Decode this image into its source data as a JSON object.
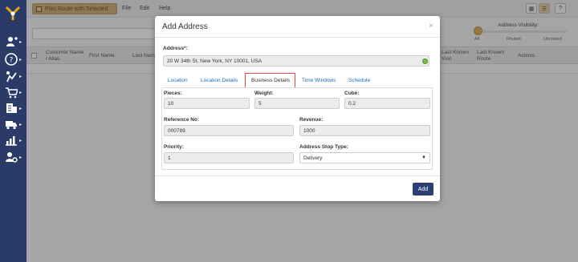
{
  "toolbar": {
    "plan_route_label": "Plan Route with Selected",
    "menu": [
      "File",
      "Edit",
      "Help"
    ]
  },
  "address_visibility": {
    "title": "Address Visibility:",
    "ticks": [
      "All",
      "Routed",
      "Unrouted"
    ],
    "level": 0
  },
  "grid": {
    "columns": [
      "Customer Name / Alias",
      "First Name",
      "Last Name",
      "Last Known Visit",
      "Last Known Route",
      "Actions"
    ]
  },
  "modal": {
    "title": "Add Address",
    "close": "×",
    "address_label": "Address*:",
    "address_value": "20 W 34th St, New York, NY 10001, USA",
    "tabs": [
      "Location",
      "Location Details",
      "Business Details",
      "Time Windows",
      "Schedule"
    ],
    "active_tab": "Business Details",
    "fields": {
      "pieces_label": "Pieces:",
      "pieces_value": "10",
      "weight_label": "Weight:",
      "weight_value": "5",
      "cube_label": "Cube:",
      "cube_value": "0.2",
      "reference_label": "Reference No:",
      "reference_value": "000789",
      "revenue_label": "Revenue:",
      "revenue_value": "1000",
      "priority_label": "Priority:",
      "priority_value": "1",
      "stop_type_label": "Address Stop Type:",
      "stop_type_value": "Delivery"
    },
    "add_button": "Add"
  },
  "colors": {
    "sidebar": "#2a3b68",
    "accent_button": "#c9a463",
    "primary_button": "#2b3f72",
    "tab_highlight": "#e0483c",
    "link": "#1e6bb8"
  }
}
